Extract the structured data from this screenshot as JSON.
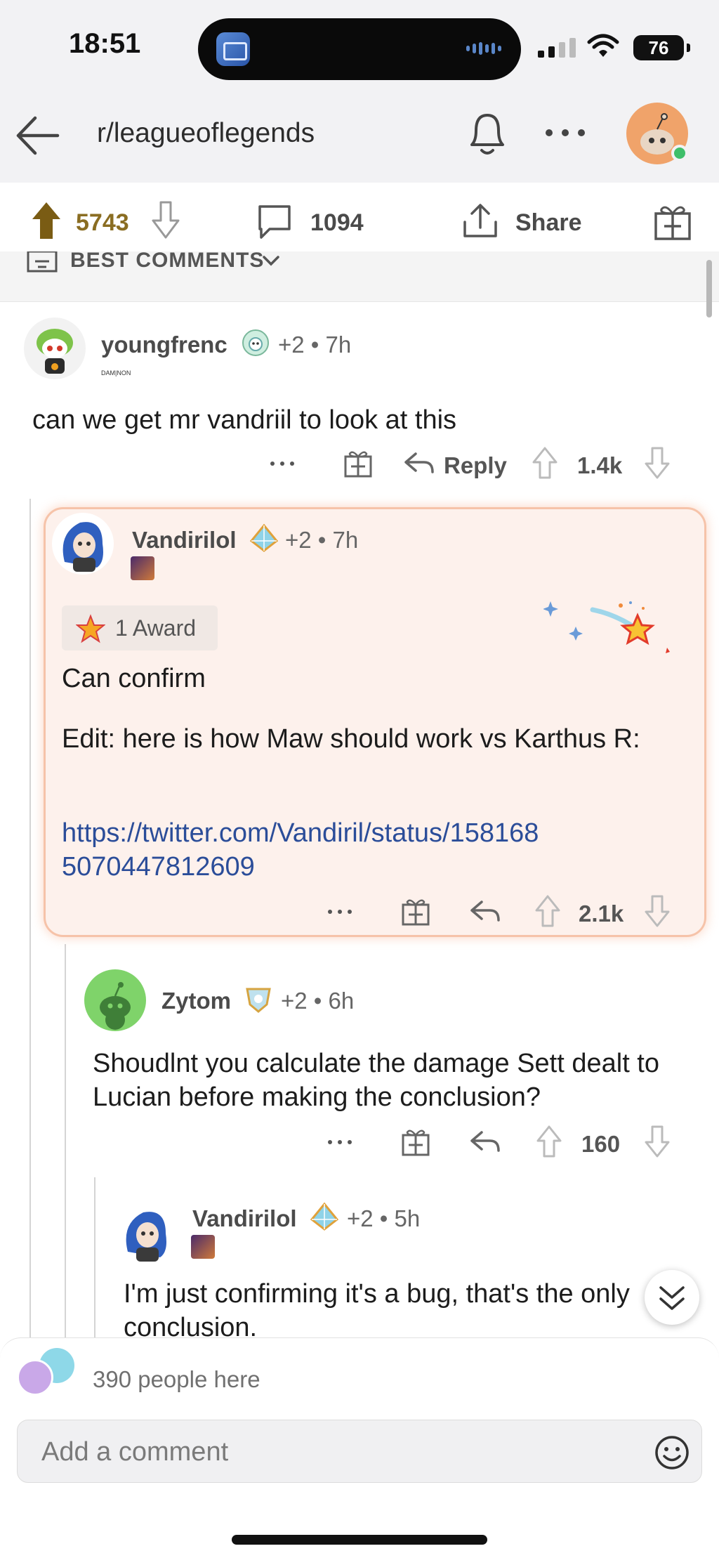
{
  "status_bar": {
    "time": "18:51",
    "battery": "76"
  },
  "header": {
    "subreddit": "r/leagueoflegends"
  },
  "post_actions": {
    "score": "5743",
    "comments": "1094",
    "share_label": "Share"
  },
  "sort": {
    "label": "BEST COMMENTS"
  },
  "comments": [
    {
      "author": "youngfrenc",
      "meta": "+2 • 7h",
      "flair": "DAM|NON",
      "body": "can we get mr vandriil to look at this",
      "reply_label": "Reply",
      "score": "1.4k"
    },
    {
      "author": "Vandirilol",
      "meta": "+2 • 7h",
      "award": "1 Award",
      "body_lines": [
        "Can confirm",
        "Edit: here is how Maw should work vs Karthus R:"
      ],
      "link": "https://twitter.com/Vandiril/status/1581685070447812609",
      "score": "2.1k"
    },
    {
      "author": "Zytom",
      "meta": "+2 • 6h",
      "body": "Shoudlnt you calculate the damage Sett dealt to Lucian before making the conclusion?",
      "score": "160"
    },
    {
      "author": "Vandirilol",
      "meta": "+2 • 5h",
      "body": "I'm just confirming it's a bug, that's the only conclusion."
    }
  ],
  "bottom": {
    "presence": "390 people here",
    "comment_placeholder": "Add a comment"
  },
  "colors": {
    "upvoted": "#8a6d22",
    "link": "#2b4d99",
    "highlight_bg": "#fdf1ec",
    "highlight_border": "#f6c3a9"
  },
  "icons": [
    "back-arrow-icon",
    "bell-icon",
    "more-icon",
    "upvote-icon",
    "downvote-icon",
    "comment-icon",
    "share-icon",
    "gift-icon",
    "reply-icon",
    "chevron-down-icon",
    "emoji-icon"
  ]
}
